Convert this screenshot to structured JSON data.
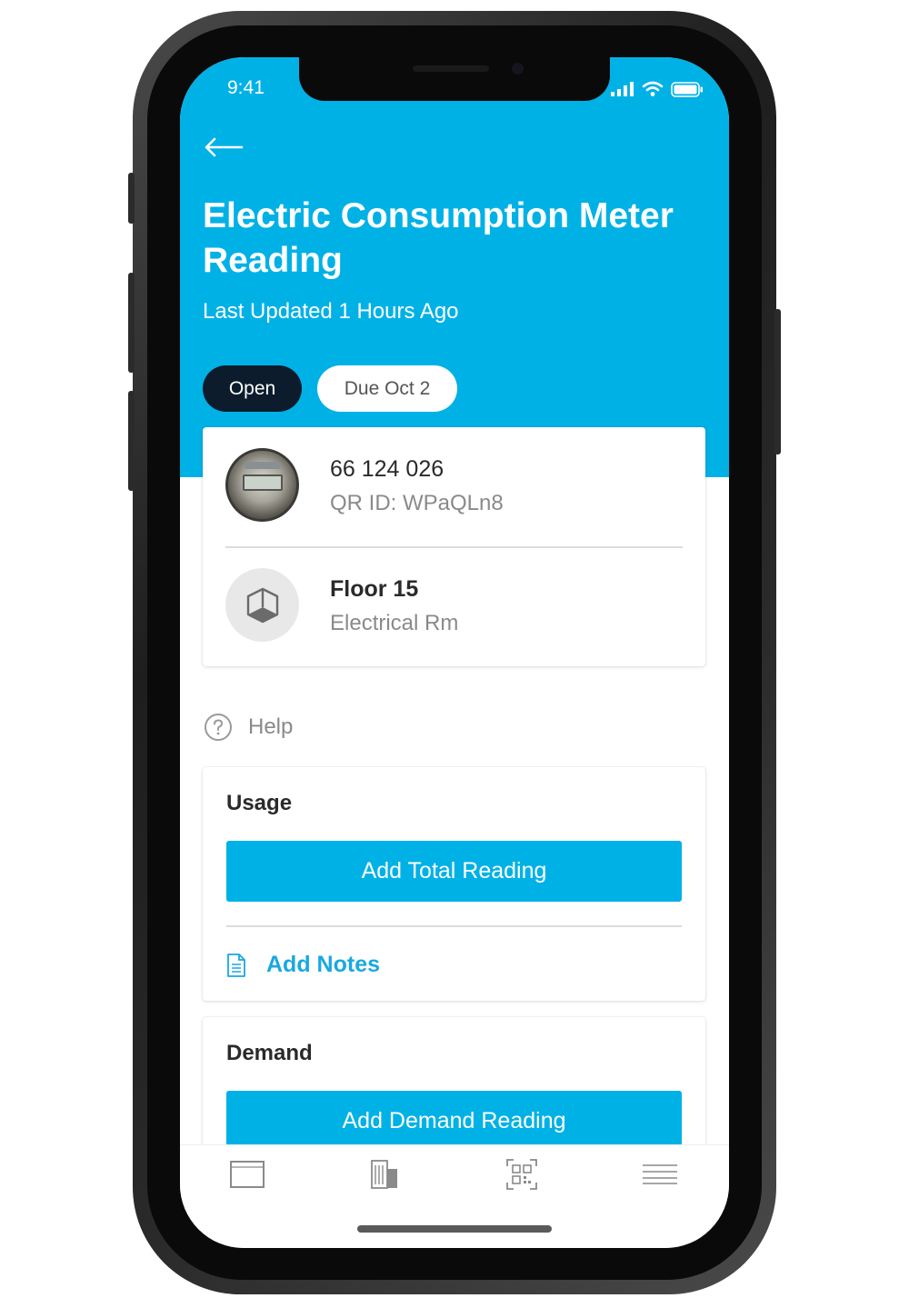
{
  "status_bar": {
    "time": "9:41",
    "icons": [
      "signal-icon",
      "wifi-icon",
      "battery-icon"
    ]
  },
  "header": {
    "back_icon": "back-arrow-icon",
    "title": "Electric Consumption Meter Reading",
    "subtitle": "Last Updated 1 Hours Ago",
    "status_pill": "Open",
    "due_pill": "Due Oct 2",
    "background_color": "#00b1e6"
  },
  "info_card": {
    "meter": {
      "id": "66 124 026",
      "qr_id": "QR ID: WPaQLn8",
      "image": "meter-photo"
    },
    "location": {
      "floor": "Floor 15",
      "room": "Electrical Rm",
      "icon": "cube-icon"
    }
  },
  "help": {
    "icon": "question-circle-icon",
    "label": "Help"
  },
  "usage": {
    "title": "Usage",
    "button_label": "Add Total Reading",
    "notes_icon": "document-icon",
    "notes_label": "Add Notes"
  },
  "demand": {
    "title": "Demand",
    "button_label": "Add Demand Reading"
  },
  "tab_bar": {
    "items": [
      {
        "icon": "dashboard-icon"
      },
      {
        "icon": "building-icon"
      },
      {
        "icon": "qr-code-icon"
      },
      {
        "icon": "menu-icon"
      }
    ]
  },
  "colors": {
    "accent": "#00b1e6",
    "dark_pill": "#0c1c2c",
    "link": "#1aa8e0"
  }
}
